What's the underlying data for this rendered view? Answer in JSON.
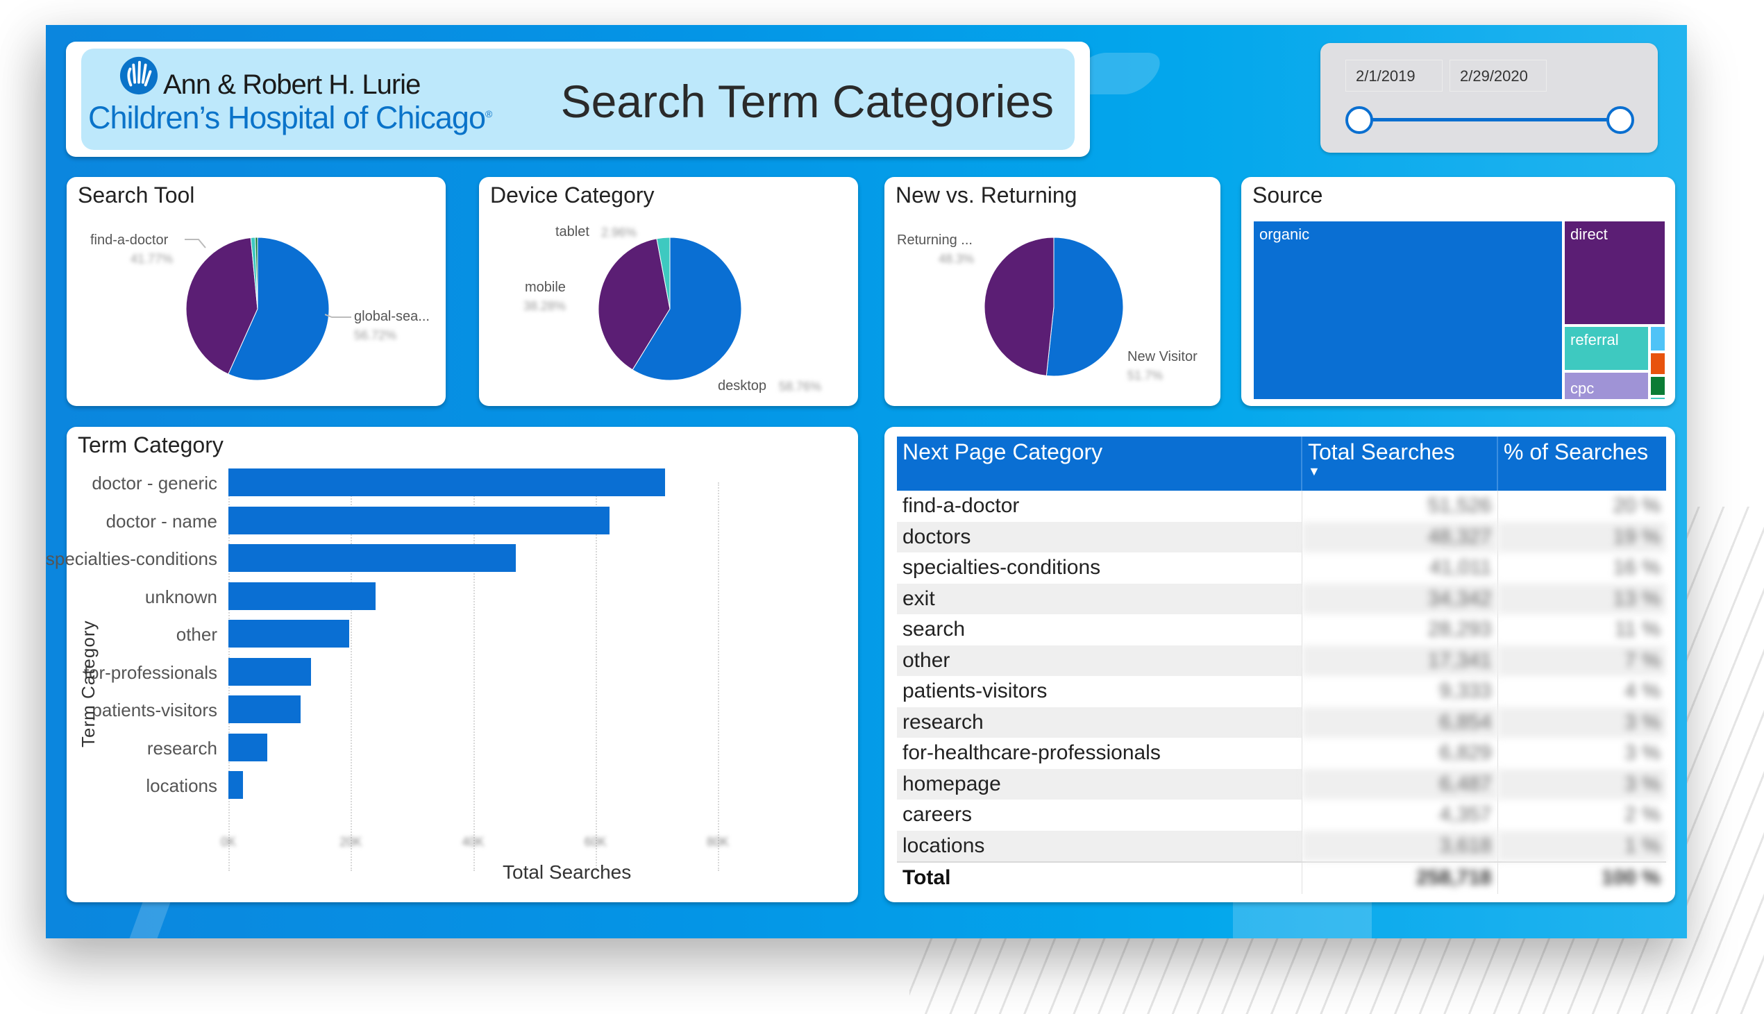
{
  "colors": {
    "primary_blue": "#0a6fd3",
    "purple": "#5b1e74",
    "teal": "#3ec9c0",
    "lavender": "#9f93d6",
    "light_blue": "#4fc3f7",
    "orange": "#e8530d",
    "green": "#0b7c35",
    "header_bg": "#bde8fb"
  },
  "header": {
    "logo_line1": "Ann & Robert H. Lurie",
    "logo_line2": "Children’s Hospital of Chicago",
    "logo_reg": "®",
    "title": "Search Term Categories"
  },
  "date_slicer": {
    "start": "2/1/2019",
    "end": "2/29/2020"
  },
  "search_tool": {
    "title": "Search Tool",
    "labels": [
      {
        "name": "find-a-doctor",
        "pct": "41.77%"
      },
      {
        "name": "global-sea...",
        "pct": "56.72%"
      }
    ]
  },
  "device_category": {
    "title": "Device Category",
    "labels": [
      {
        "name": "tablet",
        "pct": "2.96%"
      },
      {
        "name": "mobile",
        "pct": "38.28%"
      },
      {
        "name": "desktop",
        "pct": "58.76%"
      }
    ]
  },
  "new_vs_returning": {
    "title": "New vs. Returning",
    "labels": [
      {
        "name": "Returning ...",
        "pct": "48.3%"
      },
      {
        "name": "New Visitor",
        "pct": "51.7%"
      }
    ]
  },
  "source": {
    "title": "Source",
    "labels": {
      "organic": "organic",
      "direct": "direct",
      "referral": "referral",
      "cpc": "cpc"
    }
  },
  "term_category": {
    "title": "Term Category"
  },
  "next_page_table": {
    "headers": [
      "Next Page Category",
      "Total Searches",
      "% of Searches"
    ],
    "sort_indicator": "▼",
    "rows": [
      {
        "category": "find-a-doctor",
        "total": "51,526",
        "pct": "20 %"
      },
      {
        "category": "doctors",
        "total": "48,327",
        "pct": "19 %"
      },
      {
        "category": "specialties-conditions",
        "total": "41,011",
        "pct": "16 %"
      },
      {
        "category": "exit",
        "total": "34,342",
        "pct": "13 %"
      },
      {
        "category": "search",
        "total": "28,293",
        "pct": "11 %"
      },
      {
        "category": "other",
        "total": "17,341",
        "pct": "7 %"
      },
      {
        "category": "patients-visitors",
        "total": "9,333",
        "pct": "4 %"
      },
      {
        "category": "research",
        "total": "6,854",
        "pct": "3 %"
      },
      {
        "category": "for-healthcare-professionals",
        "total": "6,829",
        "pct": "3 %"
      },
      {
        "category": "homepage",
        "total": "6,487",
        "pct": "3 %"
      },
      {
        "category": "careers",
        "total": "4,357",
        "pct": "2 %"
      },
      {
        "category": "locations",
        "total": "3,618",
        "pct": "1 %"
      }
    ],
    "total": {
      "category": "Total",
      "total": "258,718",
      "pct": "100 %"
    }
  },
  "chart_data": [
    {
      "type": "pie",
      "title": "Search Tool",
      "categories": [
        "global-search",
        "find-a-doctor",
        "other-1",
        "other-2"
      ],
      "values": [
        56.72,
        41.77,
        1.0,
        0.51
      ],
      "colors": [
        "#0a6fd3",
        "#5b1e74",
        "#3ec9c0",
        "#0b7c35"
      ]
    },
    {
      "type": "pie",
      "title": "Device Category",
      "categories": [
        "desktop",
        "mobile",
        "tablet"
      ],
      "values": [
        58.76,
        38.28,
        2.96
      ],
      "colors": [
        "#0a6fd3",
        "#5b1e74",
        "#3ec9c0"
      ]
    },
    {
      "type": "pie",
      "title": "New vs. Returning",
      "categories": [
        "New Visitor",
        "Returning Visitor"
      ],
      "values": [
        51.7,
        48.3
      ],
      "colors": [
        "#0a6fd3",
        "#5b1e74"
      ]
    },
    {
      "type": "treemap",
      "title": "Source",
      "categories": [
        "organic",
        "direct",
        "referral",
        "cpc",
        "other-a",
        "other-b",
        "other-c",
        "other-d"
      ],
      "values": [
        75.0,
        14.0,
        4.5,
        3.0,
        1.2,
        1.1,
        0.9,
        0.3
      ],
      "colors": [
        "#0a6fd3",
        "#5b1e74",
        "#3ec9c0",
        "#9f93d6",
        "#4fc3f7",
        "#e8530d",
        "#0b7c35",
        "#3ec9c0"
      ]
    },
    {
      "type": "bar",
      "orientation": "horizontal",
      "title": "Term Category",
      "xlabel": "Total Searches",
      "ylabel": "Term Category",
      "categories": [
        "doctor - generic",
        "doctor - name",
        "specialties-conditions",
        "unknown",
        "other",
        "for-professionals",
        "patients-visitors",
        "research",
        "locations"
      ],
      "values": [
        71400,
        62300,
        47000,
        24100,
        19800,
        13500,
        11800,
        6400,
        2400
      ],
      "xlim": [
        0,
        80000
      ],
      "xticks": [
        "0K",
        "20K",
        "40K",
        "60K",
        "80K"
      ],
      "grid": true
    }
  ]
}
